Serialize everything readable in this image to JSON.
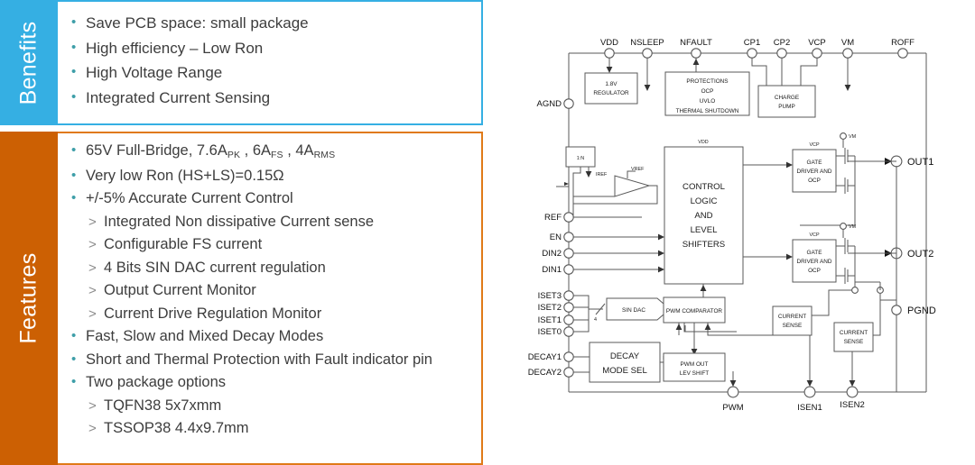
{
  "benefits": {
    "tab_label": "Benefits",
    "accent_color": "#35AFE3",
    "items": [
      "Save PCB space: small package",
      "High efficiency – Low Ron",
      "High Voltage Range",
      "Integrated Current Sensing"
    ]
  },
  "features": {
    "tab_label": "Features",
    "accent_color": "#CC6003",
    "border_color": "#E07A18",
    "items": [
      {
        "level": 0,
        "text": "65V Full-Bridge, 7.6A",
        "sub1": "PK",
        "text2": " , 6A",
        "sub2": "FS",
        "text3": " , 4A",
        "sub3": "RMS"
      },
      {
        "level": 0,
        "text": "Very low Ron (HS+LS)=0.15Ω"
      },
      {
        "level": 0,
        "text": "+/-5% Accurate Current Control"
      },
      {
        "level": 1,
        "text": "Integrated Non dissipative Current sense"
      },
      {
        "level": 1,
        "text": "Configurable FS current"
      },
      {
        "level": 1,
        "text": "4 Bits SIN DAC current regulation"
      },
      {
        "level": 1,
        "text": "Output Current Monitor"
      },
      {
        "level": 1,
        "text": "Current Drive Regulation Monitor"
      },
      {
        "level": 0,
        "text": "Fast, Slow and Mixed Decay Modes"
      },
      {
        "level": 0,
        "text": "Short and Thermal Protection with Fault indicator pin"
      },
      {
        "level": 0,
        "text": "Two package options"
      },
      {
        "level": 1,
        "text": "TQFN38 5x7xmm"
      },
      {
        "level": 1,
        "text": "TSSOP38 4.4x9.7mm"
      }
    ]
  },
  "diagram": {
    "pins_top": [
      "VDD",
      "NSLEEP",
      "NFAULT",
      "CP1",
      "CP2",
      "VCP",
      "VM",
      "ROFF"
    ],
    "pins_left": [
      "AGND",
      "REF",
      "EN",
      "DIN2",
      "DIN1",
      "ISET3",
      "ISET2",
      "ISET1",
      "ISET0",
      "DECAY1",
      "DECAY2"
    ],
    "pins_right": [
      "OUT1",
      "OUT2",
      "PGND"
    ],
    "pins_bottom": [
      "PWM",
      "ISEN1",
      "ISEN2"
    ],
    "blocks": {
      "regulator": "1.8V\nREGULATOR",
      "regulator_l1": "1.8V",
      "regulator_l2": "REGULATOR",
      "protections_l1": "PROTECTIONS",
      "protections_l2": "OCP",
      "protections_l3": "UVLO",
      "protections_l4": "THERMAL SHUTDOWN",
      "charge_pump_l1": "CHARGE",
      "charge_pump_l2": "PUMP",
      "control_l1": "CONTROL",
      "control_l2": "LOGIC",
      "control_l3": "AND",
      "control_l4": "LEVEL",
      "control_l5": "SHIFTERS",
      "control_vdd": "VDD",
      "gate_driver_l1": "GATE",
      "gate_driver_l2": "DRIVER AND",
      "gate_driver_l3": "OCP",
      "gate_driver_vcp": "VCP",
      "gate_driver_vm": "VM",
      "sin_dac": "SIN DAC",
      "sin_dac_bits": "4",
      "decay_mode_l1": "DECAY",
      "decay_mode_l2": "MODE SEL",
      "decay_signal": "DECAY",
      "pwm_comparator": "PWM COMPARATOR",
      "pwm_out_l1": "PWM OUT",
      "pwm_out_l2": "LEV SHIFT",
      "current_sense_l1": "CURRENT",
      "current_sense_l2": "SENSE",
      "ratio": "1:N",
      "iref": "IREF",
      "vref": "VREF"
    }
  }
}
